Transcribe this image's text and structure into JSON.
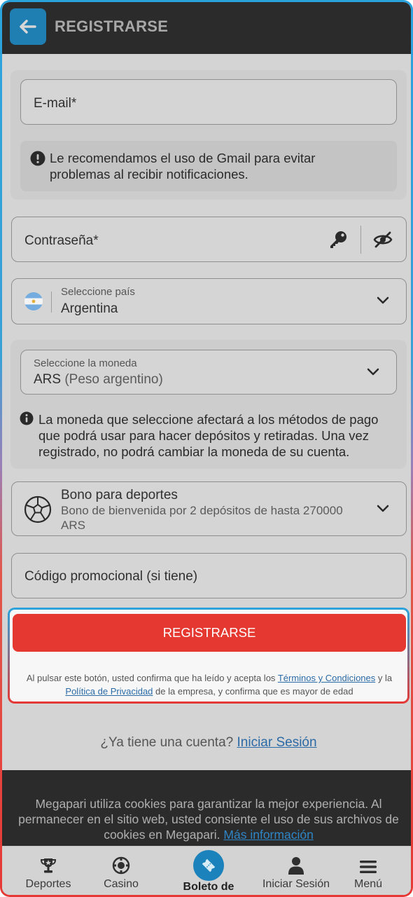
{
  "header": {
    "title": "REGISTRARSE",
    "back_icon": "arrow-left-icon"
  },
  "email": {
    "placeholder": "E-mail*",
    "note": "Le recomendamos el uso de Gmail para evitar problemas al recibir notificaciones."
  },
  "password": {
    "placeholder": "Contraseña*",
    "key_icon": "key-icon",
    "visibility_icon": "eye-off-icon"
  },
  "country": {
    "label": "Seleccione país",
    "value": "Argentina"
  },
  "currency": {
    "label": "Seleccione la moneda",
    "code": "ARS",
    "name": "(Peso argentino)",
    "note": "La moneda que seleccione afectará a los métodos de pago que podrá usar para hacer depósitos y retiradas. Una vez registrado, no podrá cambiar la moneda de su cuenta."
  },
  "bonus": {
    "title": "Bono para deportes",
    "description": "Bono de bienvenida por 2 depósitos de hasta 270000 ARS"
  },
  "promo": {
    "placeholder": "Código promocional (si tiene)"
  },
  "register": {
    "button_label": "REGISTRARSE",
    "legal_prefix": "Al pulsar este botón, usted confirma que ha leído y acepta los ",
    "terms_link": "Términos y Condiciones",
    "legal_mid": " y la ",
    "privacy_link": "Política de Privacidad",
    "legal_suffix": " de la empresa, y confirma que es mayor de edad"
  },
  "login": {
    "question": "¿Ya tiene una cuenta?",
    "link": "Iniciar Sesión"
  },
  "cookie": {
    "text": "Megapari utiliza cookies para garantizar la mejor experiencia. Al permanecer en el sitio web, usted consiente el uso de sus archivos de cookies en Megapari.",
    "link": "Más información"
  },
  "nav": {
    "sports": "Deportes",
    "casino": "Casino",
    "betslip": "Boleto de apuestas",
    "login": "Iniciar Sesión",
    "menu": "Menú"
  },
  "colors": {
    "accent_red": "#e53831",
    "accent_blue": "#1c82bb",
    "header_bg": "#2b2b2b"
  }
}
